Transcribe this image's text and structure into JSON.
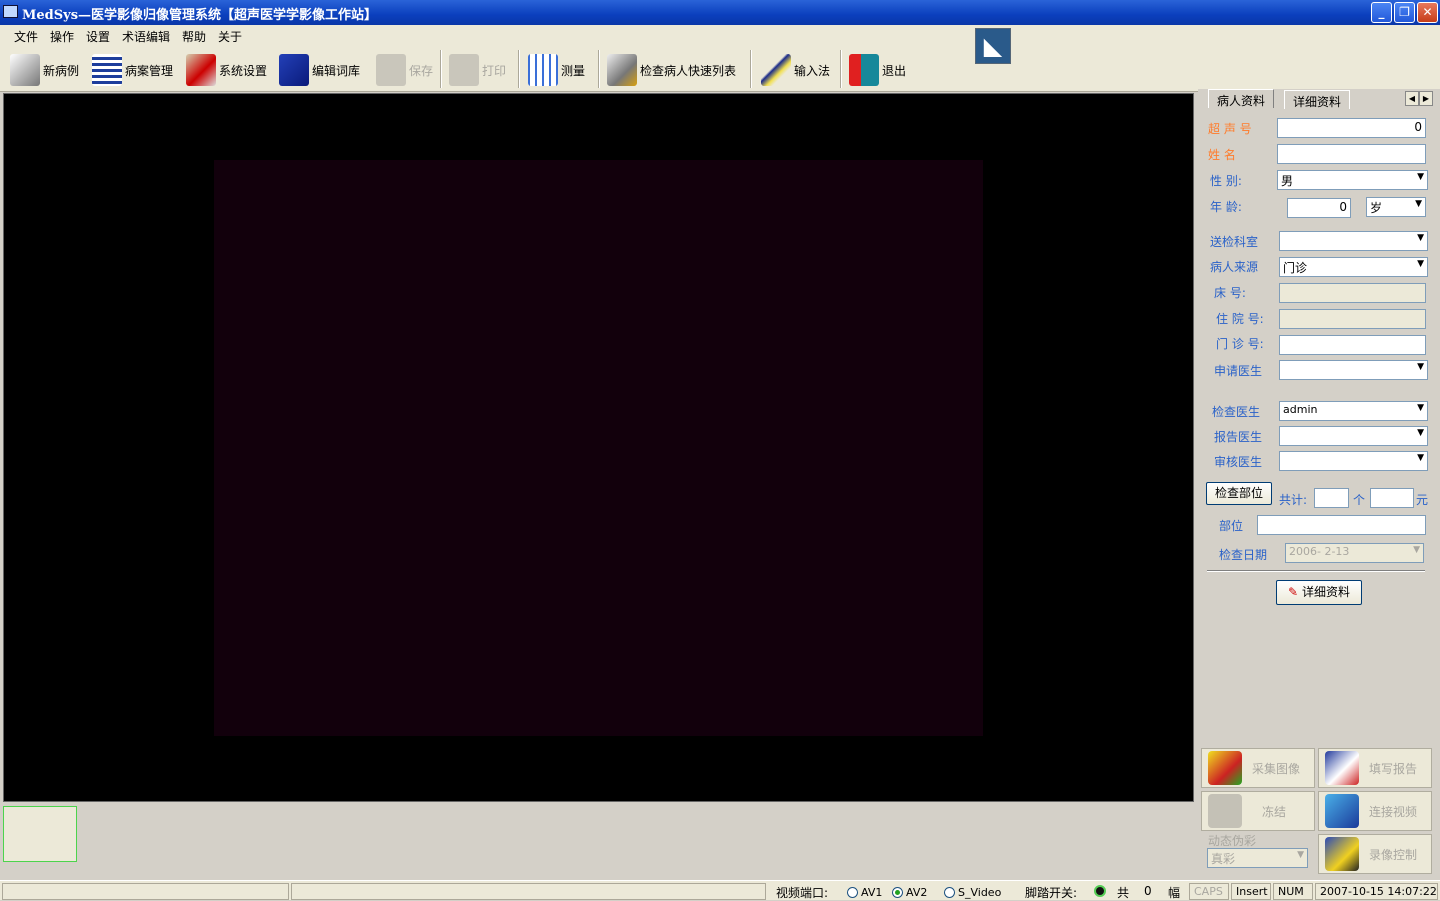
{
  "window": {
    "title": "MedSys—医学影像归像管理系统【超声医学学影像工作站】"
  },
  "menu": [
    "文件",
    "操作",
    "设置",
    "术语编辑",
    "帮助",
    "关于"
  ],
  "toolbar": [
    {
      "label": "新病例",
      "icon": "new-case-icon",
      "enabled": true
    },
    {
      "label": "病案管理",
      "icon": "records-icon",
      "enabled": true
    },
    {
      "label": "系统设置",
      "icon": "settings-check-icon",
      "enabled": true
    },
    {
      "label": "编辑词库",
      "icon": "dictionary-book-icon",
      "enabled": true
    },
    {
      "label": "保存",
      "icon": "save-icon",
      "enabled": false
    },
    {
      "label": "打印",
      "icon": "print-icon",
      "enabled": false
    },
    {
      "label": "测量",
      "icon": "measure-grid-icon",
      "enabled": true
    },
    {
      "label": "检查病人快速列表",
      "icon": "patient-list-icon",
      "enabled": true
    },
    {
      "label": "输入法",
      "icon": "pen-icon",
      "enabled": true
    },
    {
      "label": "退出",
      "icon": "exit-door-icon",
      "enabled": true
    }
  ],
  "tabs": [
    "病人资料",
    "详细资料"
  ],
  "form": {
    "us_no_label": "超 声 号",
    "us_no": "0",
    "name_label": "姓      名",
    "name": "",
    "sex_label": "性      别:",
    "sex": "男",
    "age_label": "年      龄:",
    "age": "0",
    "age_unit": "岁",
    "dept_label": "送检科室",
    "dept": "",
    "source_label": "病人来源",
    "source": "门诊",
    "bed_label": "床      号:",
    "bed": "",
    "inpatient_label": "住 院 号:",
    "inpatient": "",
    "outpatient_label": "门 诊 号:",
    "outpatient": "",
    "req_doc_label": "申请医生",
    "req_doc": "",
    "exam_doc_label": "检查医生",
    "exam_doc": "admin",
    "report_doc_label": "报告医生",
    "report_doc": "",
    "review_doc_label": "审核医生",
    "review_doc": "",
    "exam_part_btn": "检查部位",
    "total_label": "共计:",
    "count": "",
    "count_unit": "个",
    "price": "",
    "price_unit": "元",
    "part_label": "部位",
    "part": "",
    "date_label": "检查日期",
    "date": "2006- 2-13",
    "detail_btn": "详细资料"
  },
  "actions": {
    "capture": "采集图像",
    "report": "填写报告",
    "freeze": "冻结",
    "connect_video": "连接视频",
    "dynamic_color_label": "动态伪彩",
    "color_mode": "真彩",
    "record": "录像控制"
  },
  "status": {
    "video_port_label": "视频端口:",
    "ports": [
      "AV1",
      "AV2",
      "S_Video"
    ],
    "selected_port": "AV2",
    "footswitch_label": "脚踏开关:",
    "total": "共",
    "count": "0",
    "unit": "幅",
    "caps": "CAPS",
    "insert": "Insert",
    "num": "NUM",
    "datetime": "2007-10-15  14:07:22"
  }
}
